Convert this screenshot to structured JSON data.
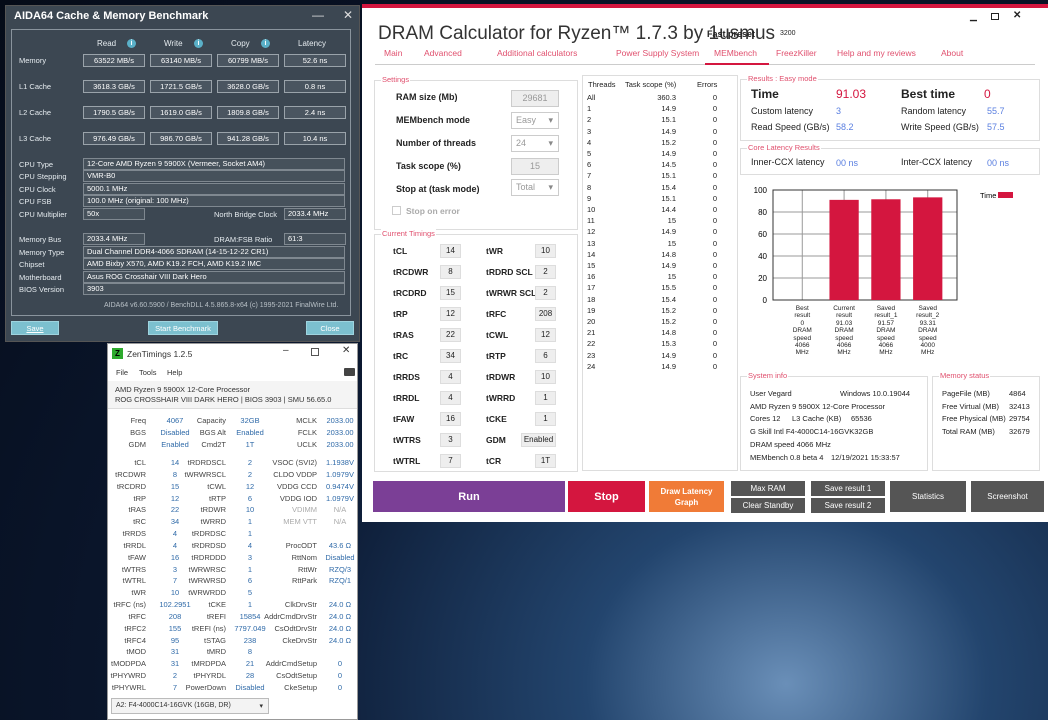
{
  "aida": {
    "title": "AIDA64 Cache & Memory Benchmark",
    "minimize": "—",
    "close": "✕",
    "headers": [
      "Read",
      "Write",
      "Copy",
      "Latency"
    ],
    "rows": [
      {
        "label": "Memory",
        "values": [
          "63522 MB/s",
          "63140 MB/s",
          "60799 MB/s",
          "52.6 ns"
        ]
      },
      {
        "label": "L1 Cache",
        "values": [
          "3618.3 GB/s",
          "1721.5 GB/s",
          "3628.0 GB/s",
          "0.8 ns"
        ]
      },
      {
        "label": "L2 Cache",
        "values": [
          "1790.5 GB/s",
          "1619.0 GB/s",
          "1809.8 GB/s",
          "2.4 ns"
        ]
      },
      {
        "label": "L3 Cache",
        "values": [
          "976.49 GB/s",
          "986.70 GB/s",
          "941.28 GB/s",
          "10.4 ns"
        ]
      }
    ],
    "cpu_type_label": "CPU Type",
    "cpu_type": "12-Core AMD Ryzen 9 5900X  (Vermeer, Socket AM4)",
    "cpu_stepping_label": "CPU Stepping",
    "cpu_stepping": "VMR-B0",
    "cpu_clock_label": "CPU Clock",
    "cpu_clock": "5000.1 MHz",
    "cpu_fsb_label": "CPU FSB",
    "cpu_fsb": "100.0 MHz  (original: 100 MHz)",
    "cpu_mult_label": "CPU Multiplier",
    "cpu_mult": "50x",
    "nb_clock_label": "North Bridge Clock",
    "nb_clock": "2033.4 MHz",
    "mem_bus_label": "Memory Bus",
    "mem_bus": "2033.4 MHz",
    "ratio_label": "DRAM:FSB Ratio",
    "ratio": "61:3",
    "mem_type_label": "Memory Type",
    "mem_type": "Dual Channel DDR4-4066 SDRAM  (14-15-12-22 CR1)",
    "chipset_label": "Chipset",
    "chipset": "AMD Bixby X570, AMD K19.2 FCH, AMD K19.2 IMC",
    "mobo_label": "Motherboard",
    "mobo": "Asus ROG Crosshair VIII Dark Hero",
    "bios_label": "BIOS Version",
    "bios": "3903",
    "footer": "AIDA64 v6.60.5900 / BenchDLL 4.5.865.8-x64  (c) 1995-2021 FinalWire Ltd.",
    "save": "Save",
    "start": "Start Benchmark",
    "close_btn": "Close"
  },
  "zen": {
    "title": "ZenTimings 1.2.5",
    "logo": "Z",
    "menu": [
      "File",
      "Tools",
      "Help"
    ],
    "cpu": "AMD Ryzen 9 5900X 12-Core Processor",
    "board": "ROG CROSSHAIR VIII DARK HERO | BIOS 3903 | SMU 56.65.0",
    "top": [
      [
        "Freq",
        "4067",
        "Capacity",
        "32GB",
        "MCLK",
        "2033.00"
      ],
      [
        "BGS",
        "Disabled",
        "BGS Alt",
        "Enabled",
        "FCLK",
        "2033.00"
      ],
      [
        "GDM",
        "Enabled",
        "Cmd2T",
        "1T",
        "UCLK",
        "2033.00"
      ]
    ],
    "rows": [
      [
        "tCL",
        "14",
        "tRDRDSCL",
        "2",
        "VSOC (SVI2)",
        "1.1938V"
      ],
      [
        "tRCDWR",
        "8",
        "tWRWRSCL",
        "2",
        "CLDO VDDP",
        "1.0979V"
      ],
      [
        "tRCDRD",
        "15",
        "tCWL",
        "12",
        "VDDG CCD",
        "0.9474V"
      ],
      [
        "tRP",
        "12",
        "tRTP",
        "6",
        "VDDG IOD",
        "1.0979V"
      ],
      [
        "tRAS",
        "22",
        "tRDWR",
        "10",
        "VDIMM",
        "N/A"
      ],
      [
        "tRC",
        "34",
        "tWRRD",
        "1",
        "MEM VTT",
        "N/A"
      ],
      [
        "tRRDS",
        "4",
        "tRDRDSC",
        "1",
        "",
        ""
      ],
      [
        "tRRDL",
        "4",
        "tRDRDSD",
        "4",
        "ProcODT",
        "43.6 Ω"
      ],
      [
        "tFAW",
        "16",
        "tRDRDDD",
        "3",
        "RttNom",
        "Disabled"
      ],
      [
        "tWTRS",
        "3",
        "tWRWRSC",
        "1",
        "RttWr",
        "RZQ/3"
      ],
      [
        "tWTRL",
        "7",
        "tWRWRSD",
        "6",
        "RttPark",
        "RZQ/1"
      ],
      [
        "tWR",
        "10",
        "tWRWRDD",
        "5",
        "",
        ""
      ],
      [
        "tRFC (ns)",
        "102.2951",
        "tCKE",
        "1",
        "ClkDrvStr",
        "24.0 Ω"
      ],
      [
        "tRFC",
        "208",
        "tREFI",
        "15854",
        "AddrCmdDrvStr",
        "24.0 Ω"
      ],
      [
        "tRFC2",
        "155",
        "tREFI (ns)",
        "7797.049",
        "CsOdtDrvStr",
        "24.0 Ω"
      ],
      [
        "tRFC4",
        "95",
        "tSTAG",
        "238",
        "CkeDrvStr",
        "24.0 Ω"
      ],
      [
        "tMOD",
        "31",
        "tMRD",
        "8",
        "",
        ""
      ],
      [
        "tMODPDA",
        "31",
        "tMRDPDA",
        "21",
        "AddrCmdSetup",
        "0"
      ],
      [
        "tPHYWRD",
        "2",
        "tPHYRDL",
        "28",
        "CsOdtSetup",
        "0"
      ],
      [
        "tPHYWRL",
        "7",
        "PowerDown",
        "Disabled",
        "CkeSetup",
        "0"
      ]
    ],
    "dimm": "A2: F4-4000C14-16GVK (16GB, DR)"
  },
  "dram": {
    "title": "DRAM Calculator for Ryzen™ 1.7.3 by 1usmus",
    "preset_label": "Fast preset",
    "preset": "3200",
    "tabs": [
      "Main",
      "Advanced",
      "Additional calculators",
      "Power Supply System",
      "MEMbench",
      "FreezKiller",
      "Help and my reviews",
      "About"
    ],
    "active_tab": "MEMbench",
    "settings": {
      "title": "Settings",
      "ram_size_label": "RAM size (Mb)",
      "ram_size": "29681",
      "mode_label": "MEMbench mode",
      "mode": "Easy",
      "threads_label": "Number of threads",
      "threads": "24",
      "scope_label": "Task scope (%)",
      "scope": "15",
      "stop_label": "Stop at (task mode)",
      "stop": "Total",
      "stop_on_error": "Stop on error"
    },
    "timings": {
      "title": "Current Timings",
      "rows": [
        [
          "tCL",
          "14",
          "tWR",
          "10"
        ],
        [
          "tRCDWR",
          "8",
          "tRDRD SCL",
          "2"
        ],
        [
          "tRCDRD",
          "15",
          "tWRWR SCL",
          "2"
        ],
        [
          "tRP",
          "12",
          "tRFC",
          "208"
        ],
        [
          "tRAS",
          "22",
          "tCWL",
          "12"
        ],
        [
          "tRC",
          "34",
          "tRTP",
          "6"
        ],
        [
          "tRRDS",
          "4",
          "tRDWR",
          "10"
        ],
        [
          "tRRDL",
          "4",
          "tWRRD",
          "1"
        ],
        [
          "tFAW",
          "16",
          "tCKE",
          "1"
        ],
        [
          "tWTRS",
          "3",
          "GDM",
          "Enabled"
        ],
        [
          "tWTRL",
          "7",
          "tCR",
          "1T"
        ]
      ]
    },
    "threads_table": {
      "headers": [
        "Threads",
        "Task scope (%)",
        "Errors"
      ],
      "rows": [
        [
          "All",
          "360.3",
          "0"
        ],
        [
          "1",
          "14.9",
          "0"
        ],
        [
          "2",
          "15.1",
          "0"
        ],
        [
          "3",
          "14.9",
          "0"
        ],
        [
          "4",
          "15.2",
          "0"
        ],
        [
          "5",
          "14.9",
          "0"
        ],
        [
          "6",
          "14.5",
          "0"
        ],
        [
          "7",
          "15.1",
          "0"
        ],
        [
          "8",
          "15.4",
          "0"
        ],
        [
          "9",
          "15.1",
          "0"
        ],
        [
          "10",
          "14.4",
          "0"
        ],
        [
          "11",
          "15",
          "0"
        ],
        [
          "12",
          "14.9",
          "0"
        ],
        [
          "13",
          "15",
          "0"
        ],
        [
          "14",
          "14.8",
          "0"
        ],
        [
          "15",
          "14.9",
          "0"
        ],
        [
          "16",
          "15",
          "0"
        ],
        [
          "17",
          "15.5",
          "0"
        ],
        [
          "18",
          "15.4",
          "0"
        ],
        [
          "19",
          "15.2",
          "0"
        ],
        [
          "20",
          "15.2",
          "0"
        ],
        [
          "21",
          "14.8",
          "0"
        ],
        [
          "22",
          "15.3",
          "0"
        ],
        [
          "23",
          "14.9",
          "0"
        ],
        [
          "24",
          "14.9",
          "0"
        ]
      ]
    },
    "results": {
      "title": "Results : Easy mode",
      "time_label": "Time",
      "time": "91.03",
      "best_label": "Best time",
      "best": "0",
      "custom_label": "Custom latency",
      "custom": "3",
      "random_label": "Random latency",
      "random": "55.7",
      "read_label": "Read Speed (GB/s)",
      "read": "58.2",
      "write_label": "Write Speed (GB/s)",
      "write": "57.5"
    },
    "core": {
      "title": "Core Latency Results",
      "inner_label": "Inner-CCX latency",
      "inner": "00 ns",
      "inter_label": "Inter-CCX latency",
      "inter": "00 ns"
    },
    "sysinfo": {
      "title": "System info",
      "user": "User Vegard",
      "os": "Windows 10.0.19044",
      "cpu": "AMD Ryzen 9 5900X 12-Core Processor",
      "cores": "Cores 12",
      "l3_label": "L3 Cache (KB)",
      "l3": "65536",
      "mem": "G Skill Intl F4-4000C14-16GVK32GB",
      "speed": "DRAM speed 4066 MHz",
      "ver": "MEMbench 0.8 beta 4",
      "date": "12/19/2021 15:33:57"
    },
    "memstatus": {
      "title": "Memory status",
      "rows": [
        [
          "PageFile (MB)",
          "4864"
        ],
        [
          "Free Virtual (MB)",
          "32413"
        ],
        [
          "Free Physical (MB)",
          "29754"
        ],
        [
          "Total RAM (MB)",
          "32679"
        ]
      ]
    },
    "buttons": {
      "run": "Run",
      "stop": "Stop",
      "draw": "Draw Latency Graph",
      "max_ram": "Max RAM",
      "clear": "Clear Standby",
      "save1": "Save result 1",
      "save2": "Save result 2",
      "stats": "Statistics",
      "shot": "Screenshot"
    },
    "colors": {
      "accent": "#d4163f",
      "run": "#7b3f96",
      "draw": "#f07b37",
      "value": "#5a7fe0"
    }
  },
  "chart_data": {
    "type": "bar",
    "legend": [
      "Time"
    ],
    "legend_position": "top-right",
    "ylim": [
      0,
      100
    ],
    "yticks": [
      "0",
      "20",
      "40",
      "60",
      "80",
      "100"
    ],
    "categories": [
      "Best result 0 DRAM speed 4066 MHz",
      "Current result 91.03 DRAM speed 4066 MHz",
      "Saved result_1 91.57 DRAM speed 4066 MHz",
      "Saved result_2 93.31 DRAM speed 4000 MHz"
    ],
    "values": [
      0,
      91.03,
      91.57,
      93.31
    ],
    "grid": true
  }
}
